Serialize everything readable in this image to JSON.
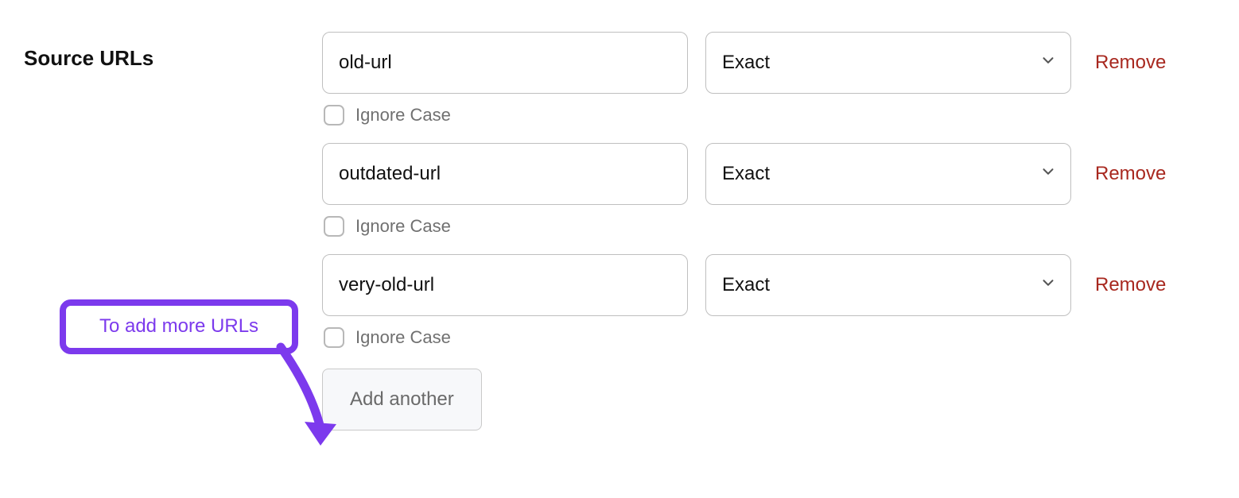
{
  "section_label": "Source URLs",
  "rows": [
    {
      "url": "old-url",
      "match": "Exact",
      "remove": "Remove",
      "ignore": "Ignore Case"
    },
    {
      "url": "outdated-url",
      "match": "Exact",
      "remove": "Remove",
      "ignore": "Ignore Case"
    },
    {
      "url": "very-old-url",
      "match": "Exact",
      "remove": "Remove",
      "ignore": "Ignore Case"
    }
  ],
  "add_button": "Add another",
  "callout_text": "To add more URLs"
}
